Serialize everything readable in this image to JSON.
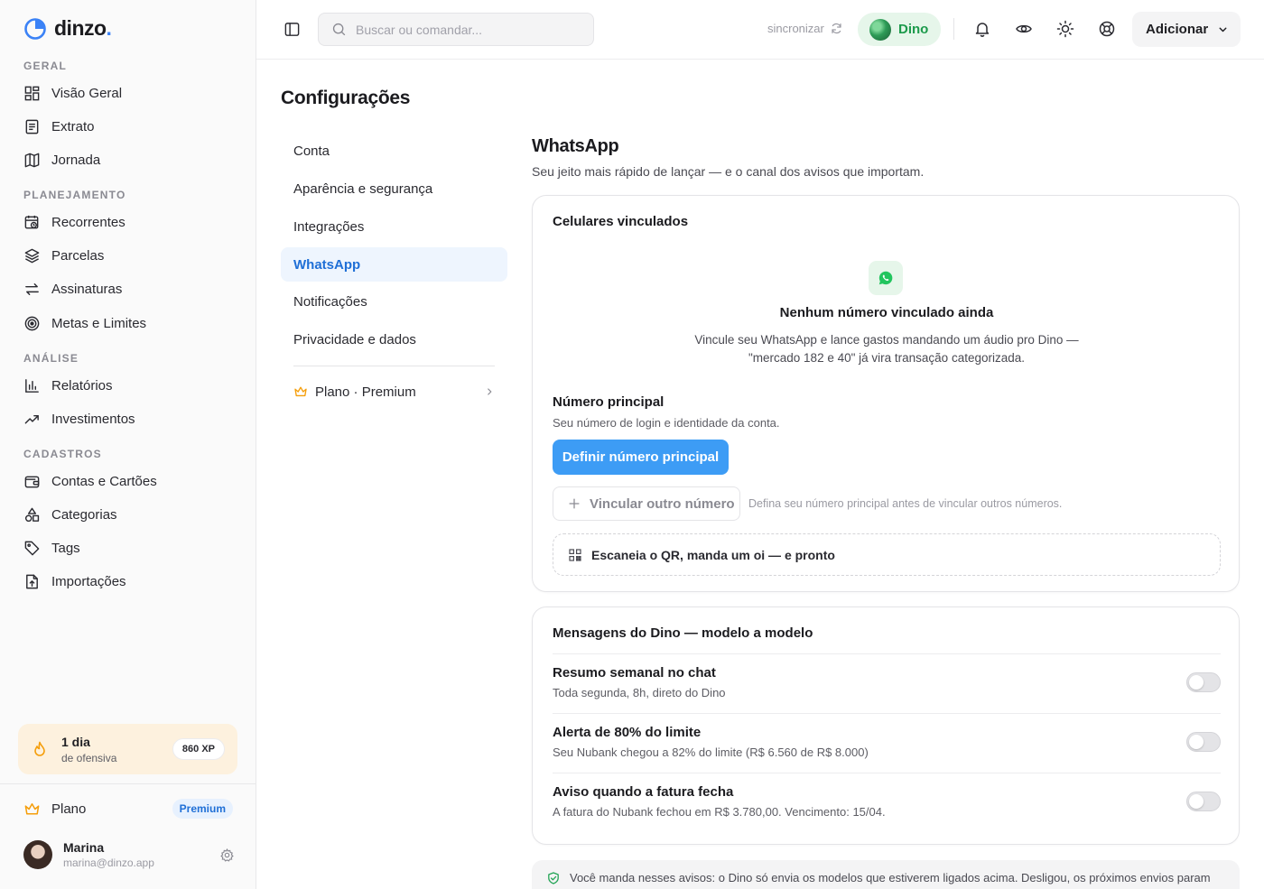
{
  "brand": {
    "name": "dinzo",
    "dot": ".",
    "accent": "#3b82f6"
  },
  "sidebar": {
    "sections": {
      "geral": "GERAL",
      "planejamento": "PLANEJAMENTO",
      "analise": "ANÁLISE",
      "cadastros": "CADASTROS"
    },
    "items": {
      "visao_geral": "Visão Geral",
      "extrato": "Extrato",
      "jornada": "Jornada",
      "recorrentes": "Recorrentes",
      "parcelas": "Parcelas",
      "assinaturas": "Assinaturas",
      "metas": "Metas e Limites",
      "relatorios": "Relatórios",
      "investimentos": "Investimentos",
      "contas": "Contas e Cartões",
      "categorias": "Categorias",
      "tags": "Tags",
      "importacoes": "Importações"
    },
    "streak": {
      "days": "1 dia",
      "label": "de ofensiva",
      "xp": "860 XP"
    },
    "plan": {
      "label": "Plano",
      "badge": "Premium"
    },
    "user": {
      "name": "Marina",
      "email": "marina@dinzo.app"
    }
  },
  "topbar": {
    "search_placeholder": "Buscar ou comandar...",
    "sync_label": "sincronizar",
    "dino_label": "Dino",
    "add_label": "Adicionar"
  },
  "page": {
    "title": "Configurações",
    "nav": [
      "Conta",
      "Aparência e segurança",
      "Integrações",
      "WhatsApp",
      "Notificações",
      "Privacidade e dados"
    ],
    "active_nav": "WhatsApp",
    "plan_link": "Plano · Premium"
  },
  "whatsapp": {
    "title": "WhatsApp",
    "subtitle": "Seu jeito mais rápido de lançar — e o canal dos avisos que importam.",
    "linked": {
      "title": "Celulares vinculados",
      "empty_title": "Nenhum número vinculado ainda",
      "empty_line1": "Vincule seu WhatsApp e lance gastos mandando um áudio pro Dino —",
      "empty_line2": "\"mercado 182 e 40\" já vira transação categorizada.",
      "primary_title": "Número principal",
      "primary_sub": "Seu número de login e identidade da conta.",
      "primary_button": "Definir número principal",
      "link_other": "Vincular outro número",
      "link_hint": "Defina seu número principal antes de vincular outros números.",
      "qr_label": "Escaneia o QR, manda um oi — e pronto"
    },
    "messages": {
      "title": "Mensagens do Dino — modelo a modelo",
      "rows": [
        {
          "title": "Resumo semanal no chat",
          "sub": "Toda segunda, 8h, direto do Dino",
          "enabled": false
        },
        {
          "title": "Alerta de 80% do limite",
          "sub": "Seu Nubank chegou a 82% do limite (R$ 6.560 de R$ 8.000)",
          "enabled": false
        },
        {
          "title": "Aviso quando a fatura fecha",
          "sub": "A fatura do Nubank fechou em R$ 3.780,00. Vencimento: 15/04.",
          "enabled": false
        }
      ]
    },
    "notice": "Você manda nesses avisos: o Dino só envia os modelos que estiverem ligados acima. Desligou, os próximos envios param"
  }
}
